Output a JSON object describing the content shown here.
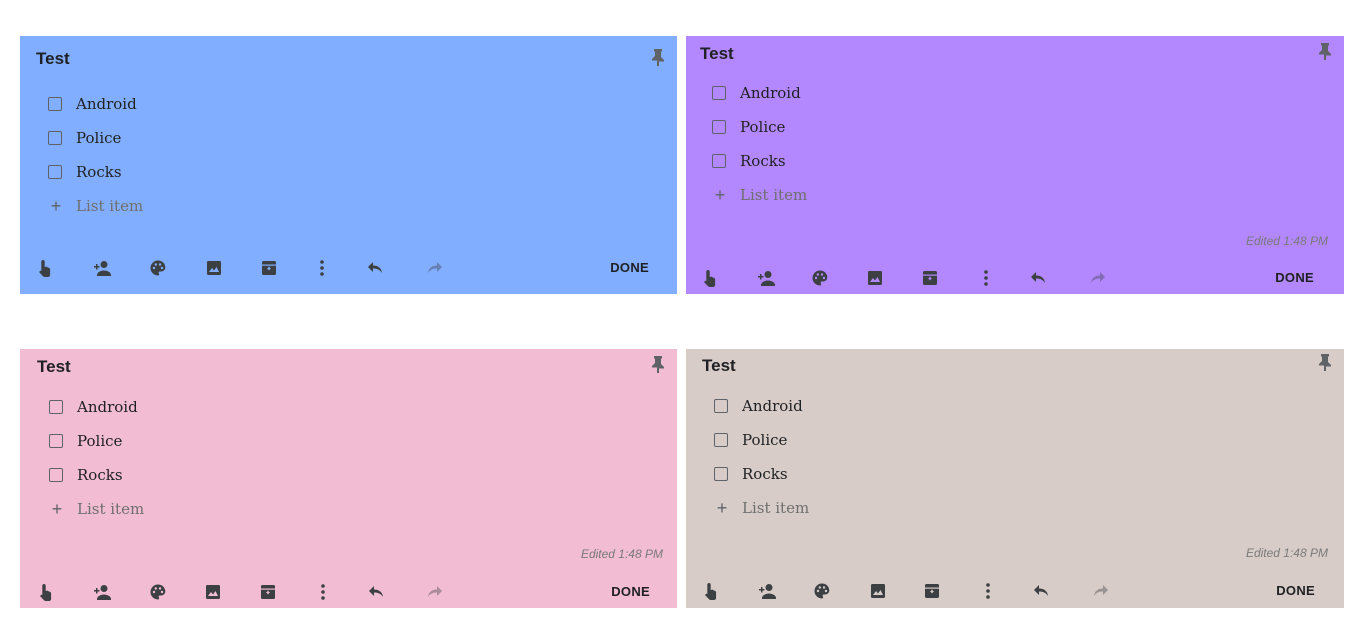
{
  "cards": [
    {
      "id": "blue",
      "color": "#82aeff",
      "title": "Test",
      "items": [
        "Android",
        "Police",
        "Rocks"
      ],
      "add_placeholder": "List item",
      "edited": "",
      "done_label": "DONE"
    },
    {
      "id": "purple",
      "color": "#b388ff",
      "title": "Test",
      "items": [
        "Android",
        "Police",
        "Rocks"
      ],
      "add_placeholder": "List item",
      "edited": "Edited 1:48 PM",
      "done_label": "DONE"
    },
    {
      "id": "pink",
      "color": "#f2bcd2",
      "title": "Test",
      "items": [
        "Android",
        "Police",
        "Rocks"
      ],
      "add_placeholder": "List item",
      "edited": "Edited 1:48 PM",
      "done_label": "DONE"
    },
    {
      "id": "beige",
      "color": "#d7ccc8",
      "title": "Test",
      "items": [
        "Android",
        "Police",
        "Rocks"
      ],
      "add_placeholder": "List item",
      "edited": "Edited 1:48 PM",
      "done_label": "DONE"
    }
  ],
  "toolbar_icons": [
    "remind-me-icon",
    "collaborator-icon",
    "palette-icon",
    "image-icon",
    "archive-icon",
    "more-options-icon",
    "undo-icon",
    "redo-icon"
  ],
  "add_symbol": "+"
}
